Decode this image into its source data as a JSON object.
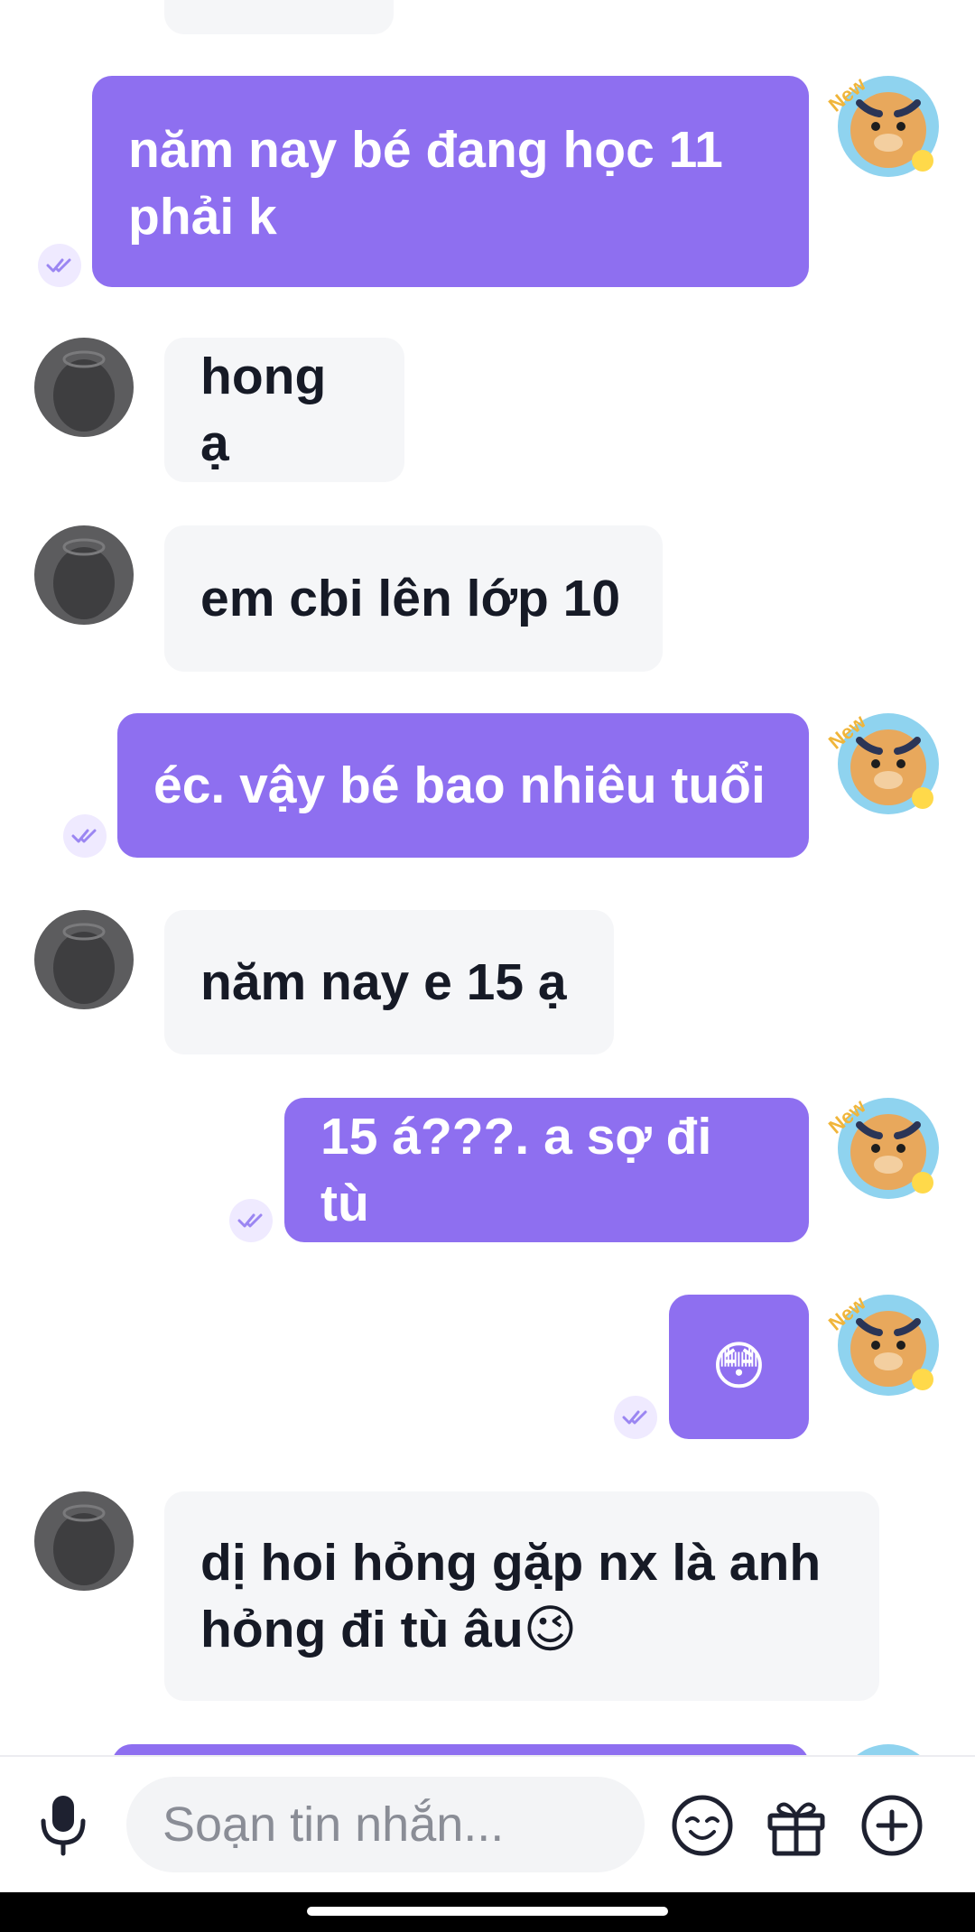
{
  "messages": [
    {
      "side": "in",
      "text": ""
    },
    {
      "side": "out",
      "text": "năm nay bé đang học 11\nphải k"
    },
    {
      "side": "in",
      "text": "hong ạ"
    },
    {
      "side": "in",
      "text": "em cbi lên lớp 10"
    },
    {
      "side": "out",
      "text": "éc. vậy bé bao nhiêu tuổi"
    },
    {
      "side": "in",
      "text": "năm nay e 15 ạ"
    },
    {
      "side": "out",
      "text": "15 á???. a sợ đi tù"
    },
    {
      "side": "out",
      "text": "😳"
    },
    {
      "side": "in",
      "text": "dị hoi hỏng gặp nx là anh\nhỏng đi tù âu😉"
    },
    {
      "side": "out",
      "text": ""
    }
  ],
  "avatar_badge": "New",
  "composer": {
    "placeholder": "Soạn tin nhắn...",
    "icons": [
      "microphone-icon",
      "emoji-icon",
      "gift-icon",
      "add-circle-icon"
    ]
  },
  "colors": {
    "outgoing_bubble": "#8e6ff0",
    "incoming_bubble": "#f5f6f8",
    "text_dark": "#161a26",
    "read_check": "#9b86f2"
  }
}
